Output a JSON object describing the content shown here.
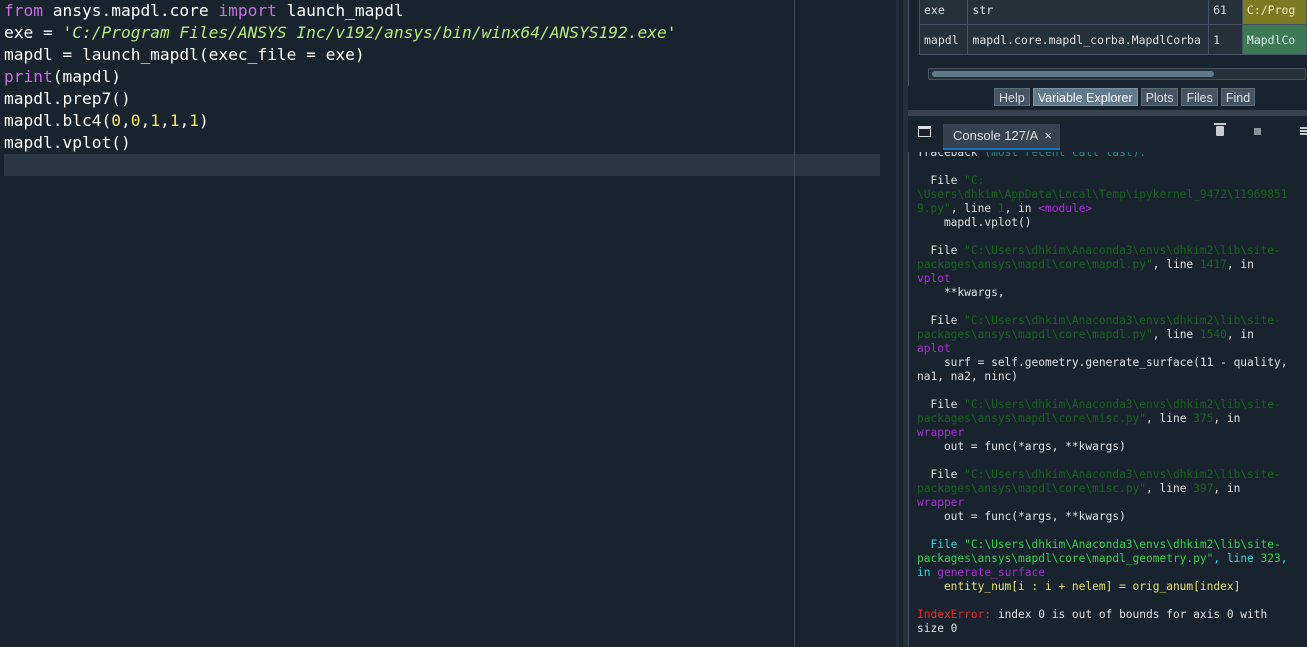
{
  "editor": {
    "lines": [
      [
        {
          "t": "from",
          "c": "kw"
        },
        {
          "t": " ansys.mapdl.core ",
          "c": "tx"
        },
        {
          "t": "import",
          "c": "kw"
        },
        {
          "t": " launch_mapdl",
          "c": "tx"
        }
      ],
      [
        {
          "t": "exe = ",
          "c": "tx"
        },
        {
          "t": "'C:/Program Files/ANSYS Inc/v192/ansys/bin/winx64/ANSYS192.exe'",
          "c": "str"
        }
      ],
      [
        {
          "t": "mapdl = launch_mapdl(exec_file = exe)",
          "c": "tx"
        }
      ],
      [
        {
          "t": "print",
          "c": "fn"
        },
        {
          "t": "(mapdl)",
          "c": "tx"
        }
      ],
      [
        {
          "t": "mapdl.prep7()",
          "c": "tx"
        }
      ],
      [
        {
          "t": "mapdl.blc4(",
          "c": "tx"
        },
        {
          "t": "0",
          "c": "num"
        },
        {
          "t": ",",
          "c": "tx"
        },
        {
          "t": "0",
          "c": "num"
        },
        {
          "t": ",",
          "c": "tx"
        },
        {
          "t": "1",
          "c": "num"
        },
        {
          "t": ",",
          "c": "tx"
        },
        {
          "t": "1",
          "c": "num"
        },
        {
          "t": ",",
          "c": "tx"
        },
        {
          "t": "1",
          "c": "num"
        },
        {
          "t": ")",
          "c": "tx"
        }
      ],
      [
        {
          "t": "mapdl.vplot()",
          "c": "tx"
        }
      ]
    ]
  },
  "variable_explorer": {
    "rows": [
      {
        "name": "exe",
        "type": "str",
        "size": "61",
        "value": "C:/Prog",
        "kind": "str"
      },
      {
        "name": "mapdl",
        "type": "mapdl.core.mapdl_corba.MapdlCorba",
        "size": "1",
        "value": "MapdlCo",
        "kind": "obj"
      }
    ]
  },
  "tabs": [
    {
      "label": "Help",
      "active": false
    },
    {
      "label": "Variable Explorer",
      "active": true
    },
    {
      "label": "Plots",
      "active": false
    },
    {
      "label": "Files",
      "active": false
    },
    {
      "label": "Find",
      "active": false
    }
  ],
  "console": {
    "tab_label": "Console 127/A",
    "close_symbol": "×",
    "lines": [
      [
        {
          "t": "Traceback ",
          "c": "wht"
        },
        {
          "t": "(most recent call last):",
          "c": "dim"
        }
      ],
      [],
      [
        {
          "t": "  File ",
          "c": "wht"
        },
        {
          "t": "\"C:",
          "c": "path"
        }
      ],
      [
        {
          "t": "\\Users\\dhkim\\AppData\\Local\\Temp\\ipykernel_9472\\11969851",
          "c": "path"
        }
      ],
      [
        {
          "t": "9.py\"",
          "c": "path"
        },
        {
          "t": ", line ",
          "c": "wht"
        },
        {
          "t": "1",
          "c": "path"
        },
        {
          "t": ", in ",
          "c": "wht"
        },
        {
          "t": "<module>",
          "c": "purple"
        }
      ],
      [
        {
          "t": "    mapdl.vplot()",
          "c": "wht"
        }
      ],
      [],
      [
        {
          "t": "  File ",
          "c": "wht"
        },
        {
          "t": "\"C:\\Users\\dhkim\\Anaconda3\\envs\\dhkim2\\lib\\site-",
          "c": "path"
        }
      ],
      [
        {
          "t": "packages\\ansys\\mapdl\\core\\mapdl.py\"",
          "c": "path"
        },
        {
          "t": ", line ",
          "c": "wht"
        },
        {
          "t": "1417",
          "c": "path"
        },
        {
          "t": ", in",
          "c": "wht"
        }
      ],
      [
        {
          "t": "vplot",
          "c": "purple"
        }
      ],
      [
        {
          "t": "    **kwargs,",
          "c": "wht"
        }
      ],
      [],
      [
        {
          "t": "  File ",
          "c": "wht"
        },
        {
          "t": "\"C:\\Users\\dhkim\\Anaconda3\\envs\\dhkim2\\lib\\site-",
          "c": "path"
        }
      ],
      [
        {
          "t": "packages\\ansys\\mapdl\\core\\mapdl.py\"",
          "c": "path"
        },
        {
          "t": ", line ",
          "c": "wht"
        },
        {
          "t": "1540",
          "c": "path"
        },
        {
          "t": ", in",
          "c": "wht"
        }
      ],
      [
        {
          "t": "aplot",
          "c": "purple"
        }
      ],
      [
        {
          "t": "    surf = self.geometry.generate_surface(11 - quality,",
          "c": "wht"
        }
      ],
      [
        {
          "t": "na1, na2, ninc)",
          "c": "wht"
        }
      ],
      [],
      [
        {
          "t": "  File ",
          "c": "wht"
        },
        {
          "t": "\"C:\\Users\\dhkim\\Anaconda3\\envs\\dhkim2\\lib\\site-",
          "c": "path"
        }
      ],
      [
        {
          "t": "packages\\ansys\\mapdl\\core\\misc.py\"",
          "c": "path"
        },
        {
          "t": ", line ",
          "c": "wht"
        },
        {
          "t": "375",
          "c": "path"
        },
        {
          "t": ", in",
          "c": "wht"
        }
      ],
      [
        {
          "t": "wrapper",
          "c": "purple"
        }
      ],
      [
        {
          "t": "    out = func(*args, **kwargs)",
          "c": "wht"
        }
      ],
      [],
      [
        {
          "t": "  File ",
          "c": "wht"
        },
        {
          "t": "\"C:\\Users\\dhkim\\Anaconda3\\envs\\dhkim2\\lib\\site-",
          "c": "path"
        }
      ],
      [
        {
          "t": "packages\\ansys\\mapdl\\core\\misc.py\"",
          "c": "path"
        },
        {
          "t": ", line ",
          "c": "wht"
        },
        {
          "t": "397",
          "c": "path"
        },
        {
          "t": ", in",
          "c": "wht"
        }
      ],
      [
        {
          "t": "wrapper",
          "c": "purple"
        }
      ],
      [
        {
          "t": "    out = func(*args, **kwargs)",
          "c": "wht"
        }
      ],
      [],
      [
        {
          "t": "  File ",
          "c": "cyan"
        },
        {
          "t": "\"C:\\Users\\dhkim\\Anaconda3\\envs\\dhkim2\\lib\\site-",
          "c": "pathb"
        }
      ],
      [
        {
          "t": "packages\\ansys\\mapdl\\core\\mapdl_geometry.py\"",
          "c": "pathb"
        },
        {
          "t": ", line ",
          "c": "cyan"
        },
        {
          "t": "323",
          "c": "pathb"
        },
        {
          "t": ",",
          "c": "cyan"
        }
      ],
      [
        {
          "t": "in ",
          "c": "cyan"
        },
        {
          "t": "generate_surface",
          "c": "purple"
        }
      ],
      [
        {
          "t": "    entity_num[i : i + nelem] = orig_anum[index]",
          "c": "yel"
        }
      ],
      [],
      [
        {
          "t": "IndexError:",
          "c": "red"
        },
        {
          "t": " index 0 is out of bounds for axis 0 with",
          "c": "wht"
        }
      ],
      [
        {
          "t": "size 0",
          "c": "wht"
        }
      ]
    ]
  }
}
